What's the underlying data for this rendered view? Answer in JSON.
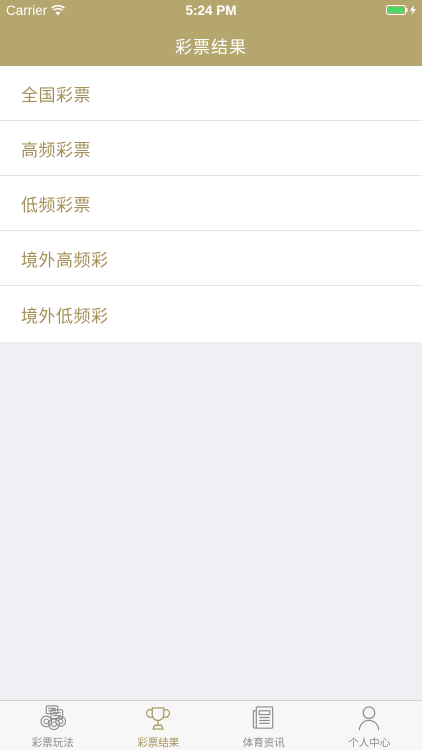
{
  "status_bar": {
    "carrier": "Carrier",
    "time": "5:24 PM",
    "wifi_icon": "wifi-icon",
    "battery_icon": "battery-icon"
  },
  "nav": {
    "title": "彩票结果"
  },
  "list": {
    "items": [
      {
        "label": "全国彩票"
      },
      {
        "label": "高频彩票"
      },
      {
        "label": "低频彩票"
      },
      {
        "label": "境外高频彩"
      },
      {
        "label": "境外低频彩"
      }
    ]
  },
  "tabbar": {
    "tabs": [
      {
        "label": "彩票玩法",
        "icon": "lottery-balls-icon",
        "active": false
      },
      {
        "label": "彩票结果",
        "icon": "trophy-icon",
        "active": true
      },
      {
        "label": "体育资讯",
        "icon": "newspaper-icon",
        "active": false
      },
      {
        "label": "个人中心",
        "icon": "person-icon",
        "active": false
      }
    ]
  },
  "colors": {
    "header_bg": "#b5a66e",
    "accent": "#a4915a",
    "page_bg": "#efeff4",
    "tab_inactive": "#8a8a8a",
    "battery": "#4cd964"
  }
}
